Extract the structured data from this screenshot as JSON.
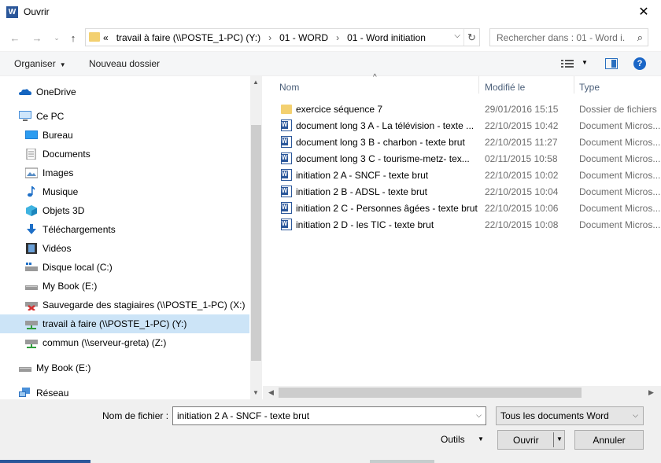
{
  "window": {
    "title": "Ouvrir",
    "app_icon": "W"
  },
  "nav": {
    "address_crumbs": [
      "«",
      "travail à faire (\\\\POSTE_1-PC) (Y:)",
      "›",
      "01 - WORD",
      "›",
      "01 - Word initiation"
    ],
    "search_placeholder": "Rechercher dans : 01 - Word i..."
  },
  "toolbar": {
    "organize": "Organiser",
    "new_folder": "Nouveau dossier"
  },
  "sidebar": {
    "items": [
      {
        "label": "OneDrive",
        "icon": "onedrive-icon"
      },
      {
        "label": "Ce PC",
        "icon": "computer-icon"
      },
      {
        "label": "Bureau",
        "icon": "desktop-icon"
      },
      {
        "label": "Documents",
        "icon": "documents-icon"
      },
      {
        "label": "Images",
        "icon": "images-icon"
      },
      {
        "label": "Musique",
        "icon": "music-icon"
      },
      {
        "label": "Objets 3D",
        "icon": "3d-objects-icon"
      },
      {
        "label": "Téléchargements",
        "icon": "downloads-icon"
      },
      {
        "label": "Vidéos",
        "icon": "videos-icon"
      },
      {
        "label": "Disque local (C:)",
        "icon": "local-disk-icon"
      },
      {
        "label": "My Book (E:)",
        "icon": "drive-icon"
      },
      {
        "label": "Sauvegarde des stagiaires (\\\\POSTE_1-PC) (X:)",
        "icon": "network-drive-disconnected-icon"
      },
      {
        "label": "travail à faire (\\\\POSTE_1-PC) (Y:)",
        "icon": "network-drive-icon"
      },
      {
        "label": "commun (\\\\serveur-greta) (Z:)",
        "icon": "network-drive-icon"
      },
      {
        "label": "My Book (E:)",
        "icon": "drive-icon"
      },
      {
        "label": "Réseau",
        "icon": "network-icon"
      }
    ]
  },
  "list": {
    "columns": [
      "Nom",
      "Modifié le",
      "Type"
    ],
    "files": [
      {
        "name": "exercice séquence 7",
        "date": "29/01/2016 15:15",
        "type": "Dossier de fichiers",
        "icon": "folder-icon"
      },
      {
        "name": "document long 3 A - La télévision - texte ...",
        "date": "22/10/2015 10:42",
        "type": "Document Micros...",
        "icon": "word-document-icon"
      },
      {
        "name": "document long 3 B - charbon - texte brut",
        "date": "22/10/2015 11:27",
        "type": "Document Micros...",
        "icon": "word-document-icon"
      },
      {
        "name": "document long 3 C - tourisme-metz- tex...",
        "date": "02/11/2015 10:58",
        "type": "Document Micros...",
        "icon": "word-document-icon"
      },
      {
        "name": "initiation 2 A - SNCF - texte brut",
        "date": "22/10/2015 10:02",
        "type": "Document Micros...",
        "icon": "word-document-icon"
      },
      {
        "name": "initiation 2 B - ADSL - texte brut",
        "date": "22/10/2015 10:04",
        "type": "Document Micros...",
        "icon": "word-document-icon"
      },
      {
        "name": "initiation 2 C - Personnes âgées - texte brut",
        "date": "22/10/2015 10:06",
        "type": "Document Micros...",
        "icon": "word-document-icon"
      },
      {
        "name": "initiation 2 D - les TIC - texte brut",
        "date": "22/10/2015 10:08",
        "type": "Document Micros...",
        "icon": "word-document-icon"
      }
    ]
  },
  "bottom": {
    "filename_label": "Nom de fichier :",
    "filename_value": "initiation 2 A - SNCF - texte brut",
    "filetype": "Tous les documents Word",
    "tools": "Outils",
    "open": "Ouvrir",
    "cancel": "Annuler"
  }
}
